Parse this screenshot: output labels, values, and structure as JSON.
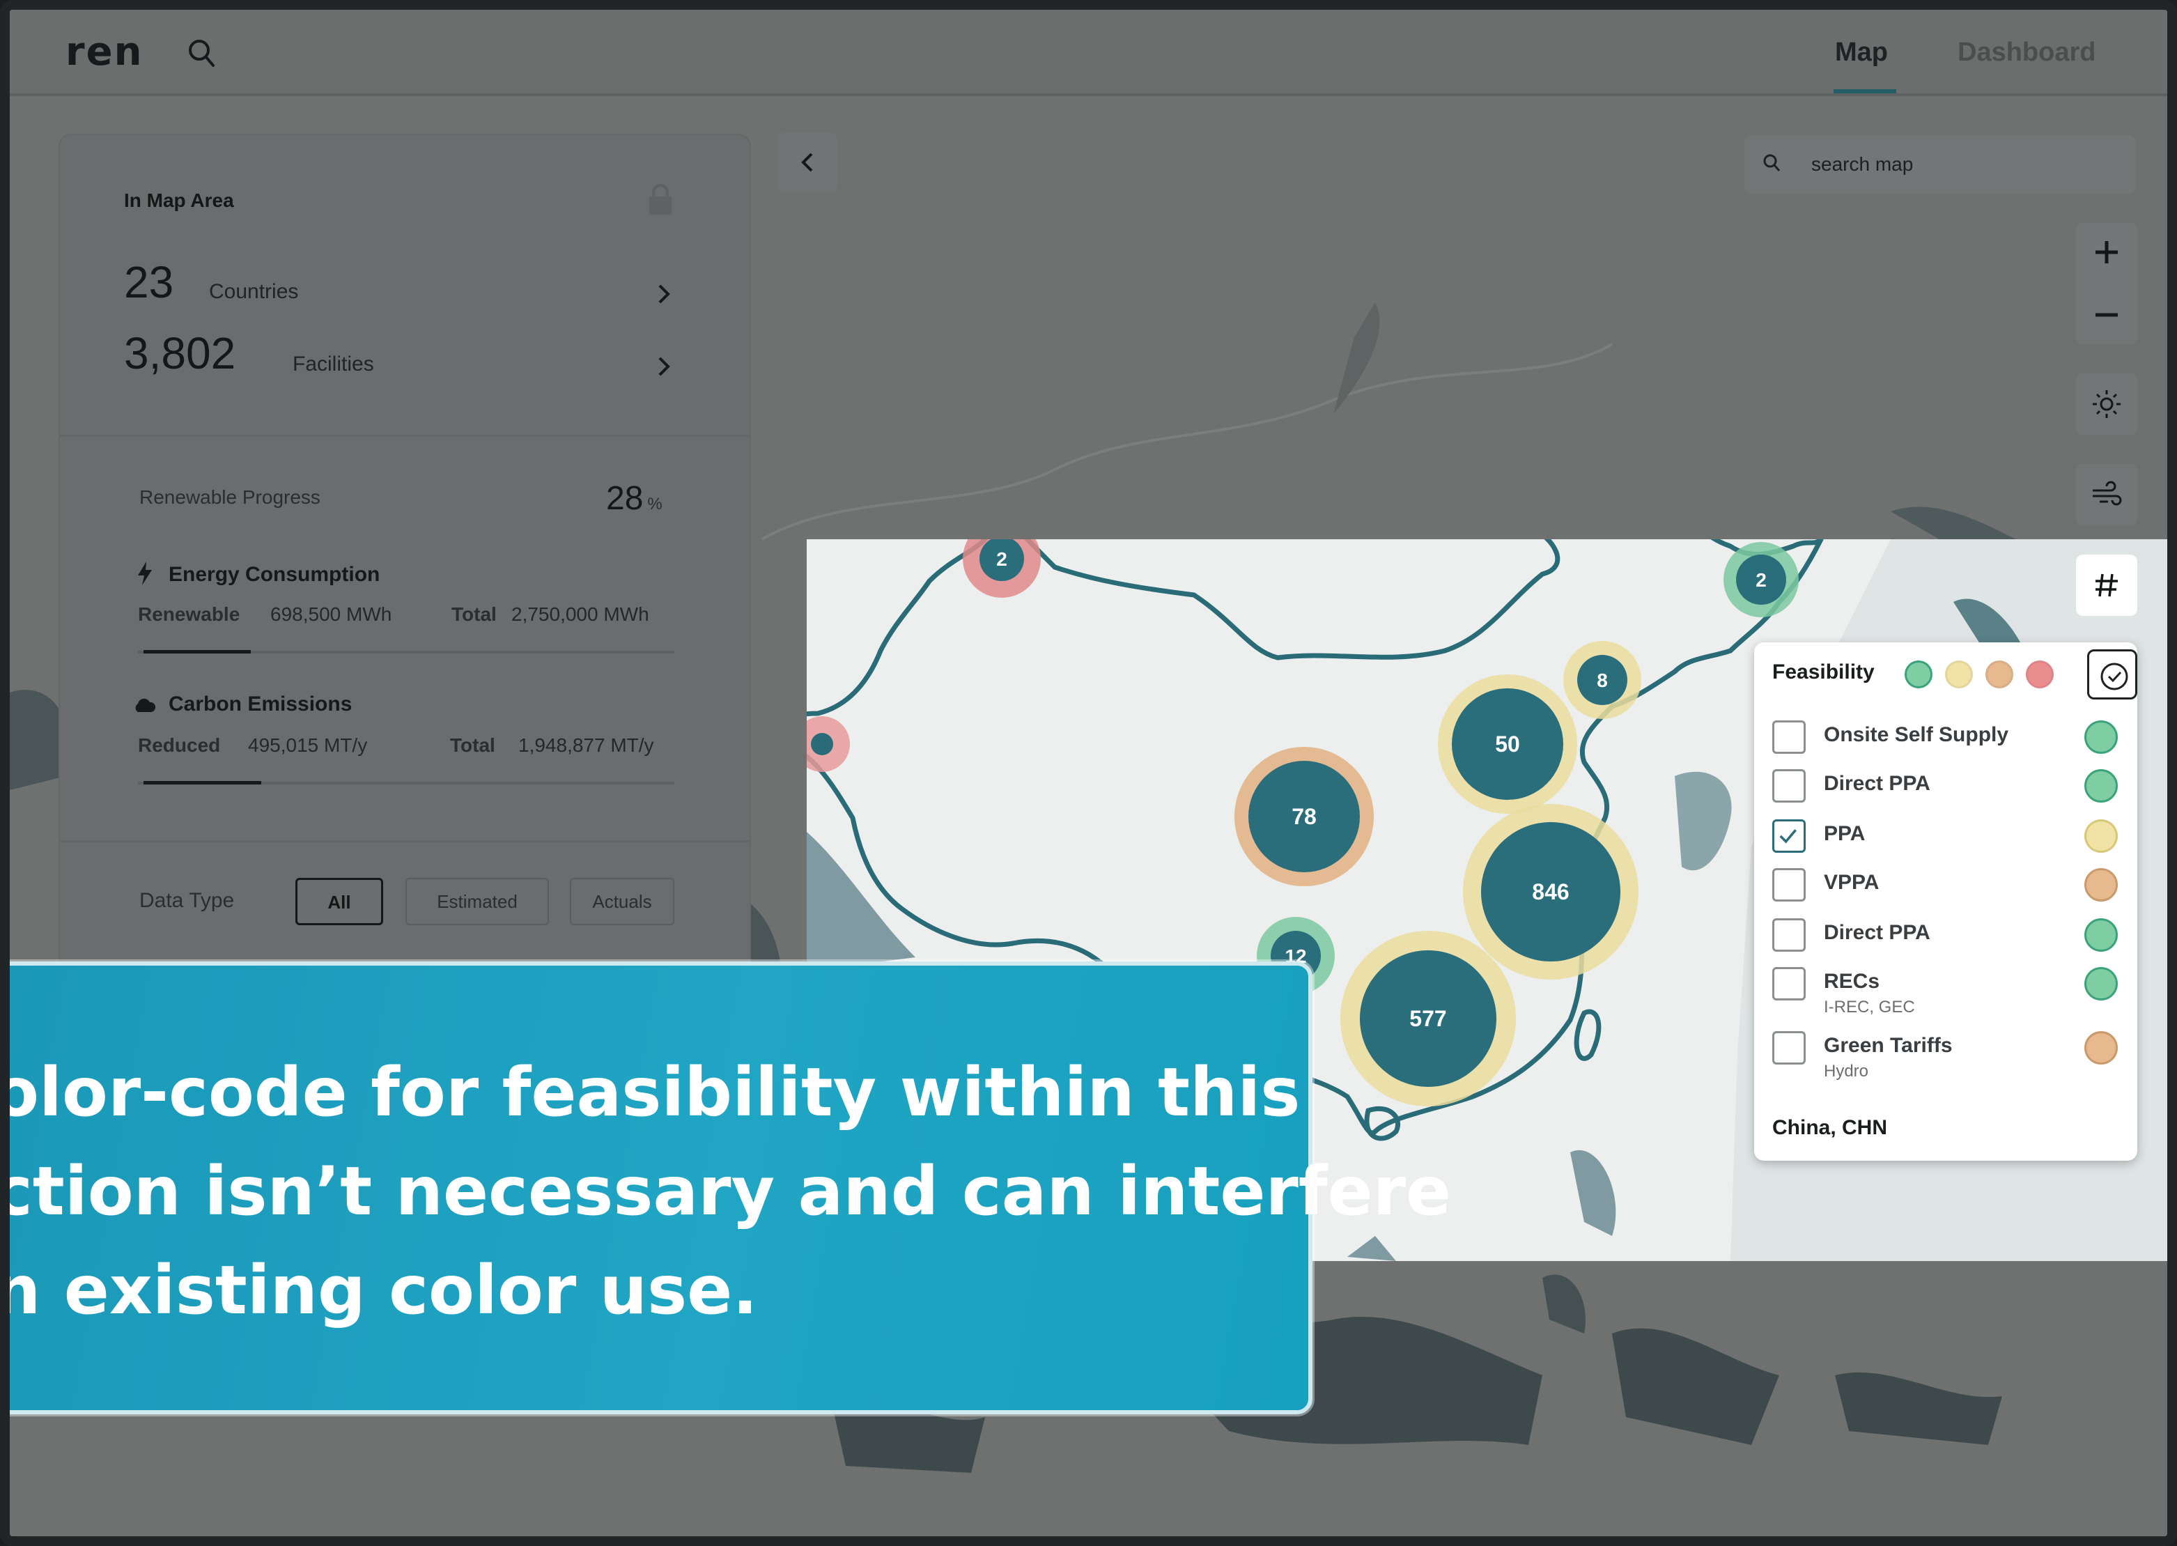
{
  "app": {
    "logo": "ren"
  },
  "nav": {
    "tabs": [
      {
        "label": "Map",
        "active": true
      },
      {
        "label": "Dashboard",
        "active": false
      }
    ]
  },
  "panel": {
    "title": "In Map Area",
    "countries": {
      "value": "23",
      "label": "Countries"
    },
    "facilities": {
      "value": "3,802",
      "label": "Facilities"
    },
    "renewable_progress": {
      "label": "Renewable Progress",
      "value": "28",
      "unit": "%"
    },
    "energy": {
      "title": "Energy Consumption",
      "renewable_label": "Renewable",
      "renewable_value": "698,500 MWh",
      "total_label": "Total",
      "total_value": "2,750,000 MWh",
      "progress": 0.2
    },
    "carbon": {
      "title": "Carbon Emissions",
      "reduced_label": "Reduced",
      "reduced_value": "495,015 MT/y",
      "total_label": "Total",
      "total_value": "1,948,877 MT/y",
      "progress": 0.22
    },
    "data_type": {
      "label": "Data Type",
      "options": [
        "All",
        "Estimated",
        "Actuals"
      ],
      "selected": "All"
    }
  },
  "map": {
    "search_placeholder": "search map",
    "clusters": [
      {
        "label": "2",
        "ring": "#e08a8a"
      },
      {
        "label": "2",
        "ring": "#7bc9a0"
      },
      {
        "label": "8",
        "ring": "#eadc9e"
      },
      {
        "label": "50",
        "ring": "#eadc9e"
      },
      {
        "label": "78",
        "ring": "#e0b080"
      },
      {
        "label": "846",
        "ring": "#eadc9e"
      },
      {
        "label": "12",
        "ring": "#7bc9a0"
      },
      {
        "label": "577",
        "ring": "#eadc9e"
      }
    ]
  },
  "feasibility": {
    "title": "Feasibility",
    "legend_colors": [
      "#7fcda3",
      "#f1e3a6",
      "#e8b98e",
      "#ea8d8f"
    ],
    "items": [
      {
        "label": "Onsite Self Supply",
        "sub": "",
        "checked": false,
        "status_color": "#7fcda3"
      },
      {
        "label": "Direct PPA",
        "sub": "",
        "checked": false,
        "status_color": "#7fcda3"
      },
      {
        "label": "PPA",
        "sub": "",
        "checked": true,
        "status_color": "#f1e3a6"
      },
      {
        "label": "VPPA",
        "sub": "",
        "checked": false,
        "status_color": "#e8b98e"
      },
      {
        "label": "Direct PPA",
        "sub": "",
        "checked": false,
        "status_color": "#7fcda3"
      },
      {
        "label": "RECs",
        "sub": "I-REC, GEC",
        "checked": false,
        "status_color": "#7fcda3"
      },
      {
        "label": "Green Tariffs",
        "sub": "Hydro",
        "checked": false,
        "status_color": "#e8b98e"
      }
    ],
    "country": "China, CHN"
  },
  "callout": {
    "lines": [
      "olor-code for feasibility within this",
      "ction isn’t necessary and can interfere",
      "n existing color use."
    ]
  }
}
